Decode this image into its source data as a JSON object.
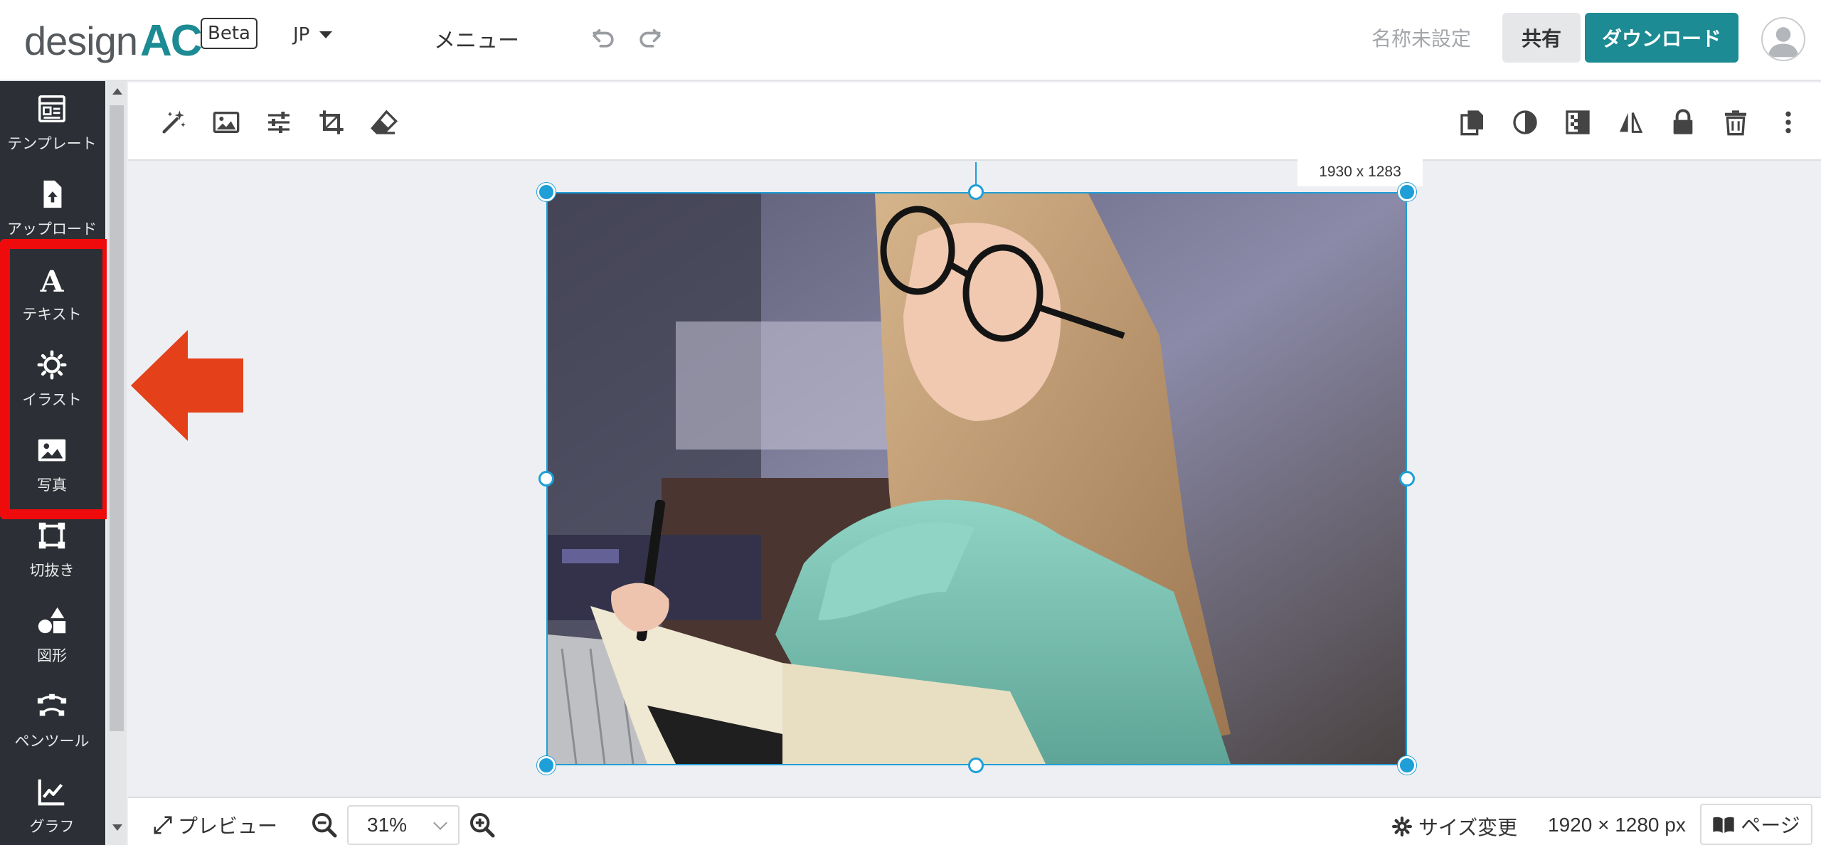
{
  "app": {
    "logo_text": "design",
    "logo_accent": "AC",
    "badge": "Beta",
    "language": "JP",
    "menu_label": "メニュー",
    "document_name": "名称未設定",
    "share_label": "共有",
    "download_label": "ダウンロード"
  },
  "sidebar": {
    "items": [
      {
        "label": "テンプレート",
        "icon": "template-icon"
      },
      {
        "label": "アップロード",
        "icon": "upload-icon"
      },
      {
        "label": "テキスト",
        "icon": "text-icon"
      },
      {
        "label": "イラスト",
        "icon": "illustration-icon"
      },
      {
        "label": "写真",
        "icon": "photo-icon"
      },
      {
        "label": "切抜き",
        "icon": "crop-frame-icon"
      },
      {
        "label": "図形",
        "icon": "shapes-icon"
      },
      {
        "label": "ペンツール",
        "icon": "pen-tool-icon"
      },
      {
        "label": "グラフ",
        "icon": "graph-icon"
      }
    ]
  },
  "toolbar": {
    "left_icons": [
      "magic-wand-icon",
      "image-icon",
      "adjust-sliders-icon",
      "crop-icon",
      "eraser-icon"
    ],
    "right_icons": [
      "copy-icon",
      "contrast-icon",
      "transparency-icon",
      "flip-icon",
      "lock-icon",
      "trash-icon",
      "more-icon"
    ]
  },
  "canvas": {
    "selection_size": "1930 x 1283"
  },
  "bottom_bar": {
    "preview_label": "プレビュー",
    "zoom_value": "31%",
    "resize_label": "サイズ変更",
    "dimensions": "1920 × 1280 px",
    "page_label": "ページ"
  },
  "colors": {
    "brand": "#1c8b93",
    "sidebar_bg": "#2c2f35",
    "highlight": "#ef0b0b",
    "selection": "#1e9fd8",
    "annotation_arrow": "#e4401a"
  }
}
